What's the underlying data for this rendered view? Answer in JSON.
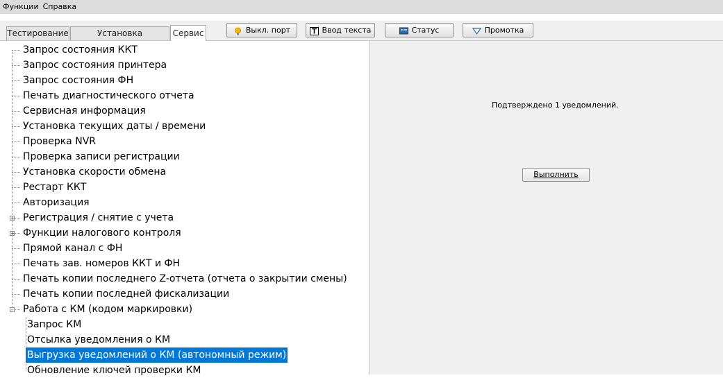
{
  "menu": [
    "Функции",
    "Справка"
  ],
  "tabs": [
    "Тестирование",
    "Установка параметров",
    "Сервис"
  ],
  "toolbar_buttons": [
    {
      "label": "Выкл. порт",
      "icon": "bulb-icon"
    },
    {
      "label": "Ввод текста",
      "icon": "text-t-icon"
    },
    {
      "label": "Статус",
      "icon": "monitor-icon"
    },
    {
      "label": "Промотка",
      "icon": "triangle-down-icon"
    }
  ],
  "tree": [
    {
      "label": "Запрос состояния ККТ"
    },
    {
      "label": "Запрос состояния принтера"
    },
    {
      "label": "Запрос состояния ФН"
    },
    {
      "label": "Печать диагностического отчета"
    },
    {
      "label": "Сервисная информация"
    },
    {
      "label": "Установка текущих даты / времени"
    },
    {
      "label": "Проверка NVR"
    },
    {
      "label": "Проверка записи регистрации"
    },
    {
      "label": "Установка скорости обмена"
    },
    {
      "label": "Рестарт ККТ"
    },
    {
      "label": "Авторизация"
    },
    {
      "label": "Регистрация / снятие с учета",
      "expander": "+"
    },
    {
      "label": "Функции налогового контроля",
      "expander": "+"
    },
    {
      "label": "Прямой канал с ФН"
    },
    {
      "label": "Печать зав. номеров ККТ и ФН"
    },
    {
      "label": "Печать копии последнего Z-отчета (отчета о закрытии смены)"
    },
    {
      "label": "Печать копии последней фискализации"
    },
    {
      "label": "Работа с КМ (кодом маркировки)",
      "expander": "-"
    },
    {
      "label": "Запрос КМ",
      "child": true
    },
    {
      "label": "Отсылка уведомления о КМ",
      "child": true
    },
    {
      "label": "Выгрузка уведомлений о КМ (автономный режим)",
      "child": true,
      "selected": true
    },
    {
      "label": "Обновление ключей проверки КМ",
      "child": true
    }
  ],
  "panel": {
    "status": "Подтверждено 1 уведомлений.",
    "execute_label": "Выполнить"
  },
  "colors": {
    "selection": "#0078d7",
    "panel_bg": "#f0f0f0"
  }
}
